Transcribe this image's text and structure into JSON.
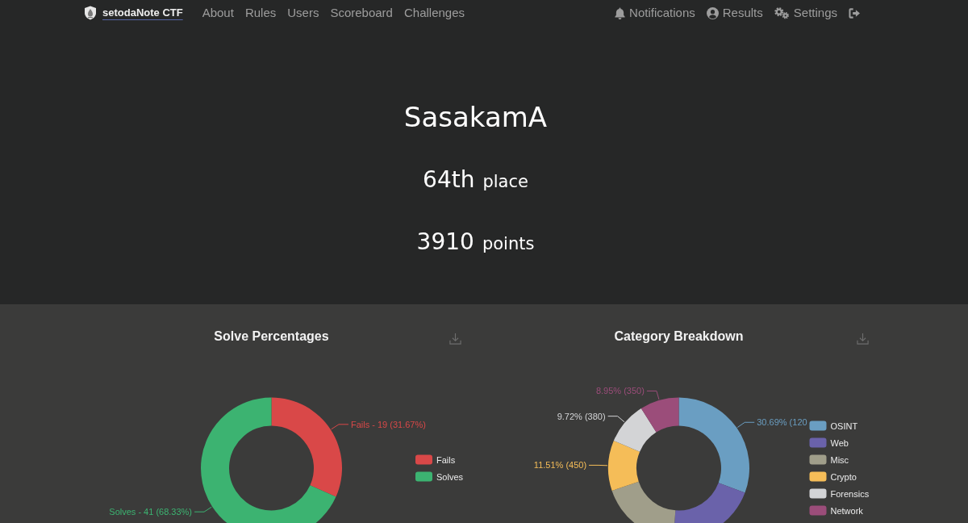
{
  "navbar": {
    "brand": "setodaNote CTF",
    "links": [
      {
        "label": "About"
      },
      {
        "label": "Rules"
      },
      {
        "label": "Users"
      },
      {
        "label": "Scoreboard"
      },
      {
        "label": "Challenges"
      }
    ],
    "right_links": [
      {
        "kind": "notifications",
        "label": "Notifications"
      },
      {
        "kind": "results",
        "label": "Results"
      },
      {
        "kind": "settings",
        "label": "Settings"
      },
      {
        "kind": "logout"
      }
    ]
  },
  "profile": {
    "name": "SasakamA",
    "place": "64th",
    "place_label": "place",
    "score": "3910",
    "score_label": "points"
  },
  "charts": [
    {
      "chart_data": {
        "type": "donut",
        "title": "Solve Percentages",
        "categories": [
          "Fails",
          "Solves"
        ],
        "values": [
          31.67,
          68.33
        ],
        "colors": [
          "#d94848",
          "#3cb371"
        ],
        "value_labels": [
          "Fails - 19 (31.67%)",
          "Solves - 41 (68.33%)"
        ],
        "legend": "right"
      }
    },
    {
      "chart_data": {
        "type": "donut",
        "title": "Category Breakdown",
        "categories": [
          "OSINT",
          "Web",
          "Misc",
          "Crypto",
          "Forensics",
          "Network"
        ],
        "values": [
          30.69,
          20.56,
          18.57,
          11.51,
          9.72,
          8.95
        ],
        "colors": [
          "#6a9ec2",
          "#6a62aa",
          "#a09e8a",
          "#f5bd58",
          "#d3d4d6",
          "#9b4d7a"
        ],
        "value_labels": [
          "30.69% (120",
          null,
          null,
          "11.51% (450)",
          "9.72% (380)",
          "8.95% (350)"
        ],
        "legend": "right"
      }
    }
  ]
}
